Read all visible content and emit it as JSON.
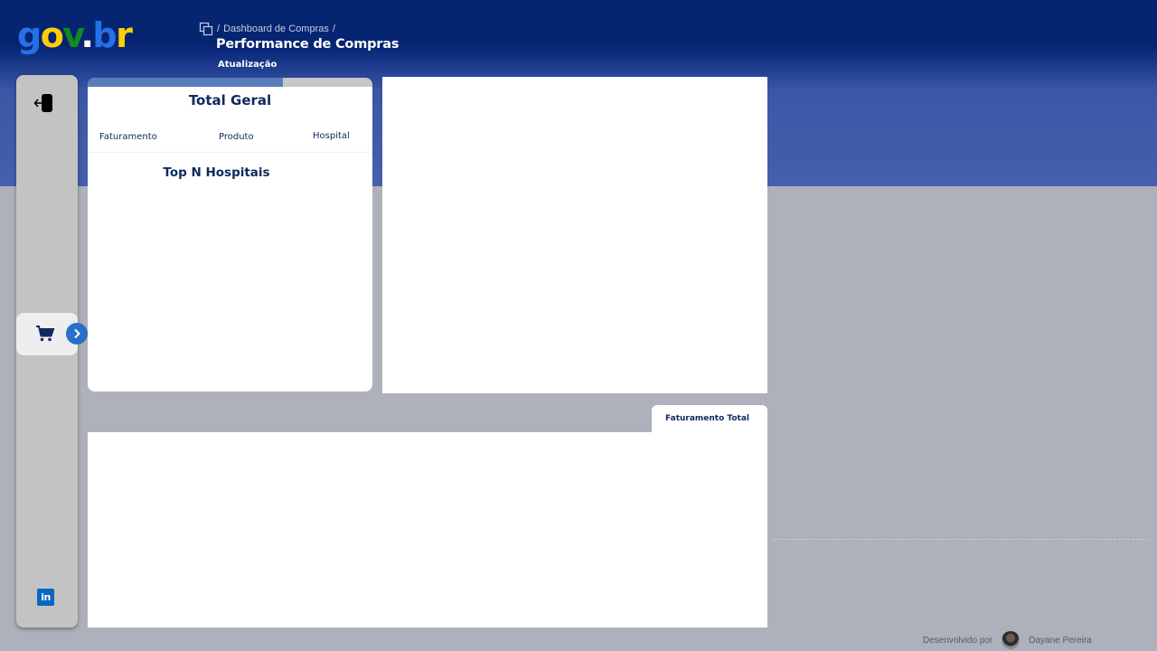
{
  "header": {
    "logo": {
      "g": "g",
      "o": "o",
      "v": "v",
      "dot": ".",
      "b": "b",
      "r": "r"
    },
    "breadcrumb": {
      "sep1": "/",
      "parent": "Dashboard de Compras",
      "sep2": "/"
    },
    "page_title": "Performance de Compras",
    "update_label": "Atualização"
  },
  "sidebar": {
    "icons": {
      "exit": "exit-icon",
      "cart": "cart-icon",
      "expand": "chevron-right-icon",
      "linkedin": "linkedin-icon"
    },
    "linkedin_text": "in"
  },
  "filter_card": {
    "title": "Total Geral",
    "filters": [
      "Faturamento",
      "Produto",
      "Hospital"
    ],
    "section_title": "Top N Hospitais"
  },
  "bottom_panel": {
    "tab_label": "Faturamento Total"
  },
  "footer": {
    "prefix": "Desenvolvido por",
    "author": "Dayane Pereira"
  },
  "colors": {
    "header": "#062571",
    "header_light": "#4560ac",
    "background": "#aeb1bb",
    "sidebar": "#c3c3c3",
    "accent": "#2870c8",
    "title_text": "#0d2a5c"
  }
}
